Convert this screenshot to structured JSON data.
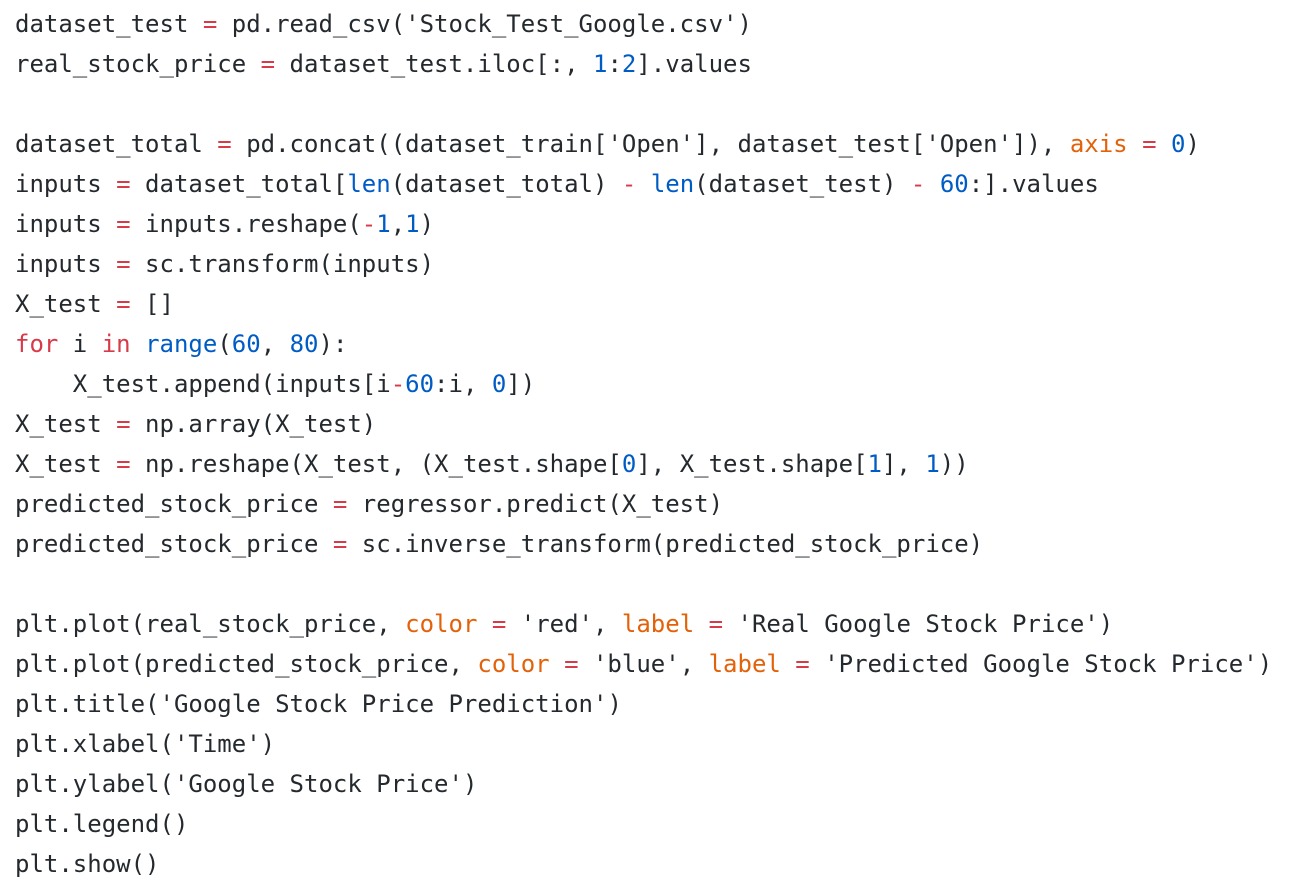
{
  "code": {
    "lines": [
      [
        [
          "t",
          "dataset_test "
        ],
        [
          "o",
          "="
        ],
        [
          "t",
          " pd.read_csv("
        ],
        [
          "s",
          "'Stock_Test_Google.csv'"
        ],
        [
          "t",
          ")"
        ]
      ],
      [
        [
          "t",
          "real_stock_price "
        ],
        [
          "o",
          "="
        ],
        [
          "t",
          " dataset_test.iloc[:, "
        ],
        [
          "n",
          "1"
        ],
        [
          "t",
          ":"
        ],
        [
          "n",
          "2"
        ],
        [
          "t",
          "].values"
        ]
      ],
      [],
      [
        [
          "t",
          "dataset_total "
        ],
        [
          "o",
          "="
        ],
        [
          "t",
          " pd.concat((dataset_train["
        ],
        [
          "s",
          "'Open'"
        ],
        [
          "t",
          "], dataset_test["
        ],
        [
          "s",
          "'Open'"
        ],
        [
          "t",
          "]), "
        ],
        [
          "p",
          "axis"
        ],
        [
          "t",
          " "
        ],
        [
          "o",
          "="
        ],
        [
          "t",
          " "
        ],
        [
          "n",
          "0"
        ],
        [
          "t",
          ")"
        ]
      ],
      [
        [
          "t",
          "inputs "
        ],
        [
          "o",
          "="
        ],
        [
          "t",
          " dataset_total["
        ],
        [
          "b",
          "len"
        ],
        [
          "t",
          "(dataset_total) "
        ],
        [
          "o",
          "-"
        ],
        [
          "t",
          " "
        ],
        [
          "b",
          "len"
        ],
        [
          "t",
          "(dataset_test) "
        ],
        [
          "o",
          "-"
        ],
        [
          "t",
          " "
        ],
        [
          "n",
          "60"
        ],
        [
          "t",
          ":].values"
        ]
      ],
      [
        [
          "t",
          "inputs "
        ],
        [
          "o",
          "="
        ],
        [
          "t",
          " inputs.reshape("
        ],
        [
          "o",
          "-"
        ],
        [
          "n",
          "1"
        ],
        [
          "t",
          ","
        ],
        [
          "n",
          "1"
        ],
        [
          "t",
          ")"
        ]
      ],
      [
        [
          "t",
          "inputs "
        ],
        [
          "o",
          "="
        ],
        [
          "t",
          " sc.transform(inputs)"
        ]
      ],
      [
        [
          "t",
          "X_test "
        ],
        [
          "o",
          "="
        ],
        [
          "t",
          " []"
        ]
      ],
      [
        [
          "k",
          "for"
        ],
        [
          "t",
          " i "
        ],
        [
          "k",
          "in"
        ],
        [
          "t",
          " "
        ],
        [
          "b",
          "range"
        ],
        [
          "t",
          "("
        ],
        [
          "n",
          "60"
        ],
        [
          "t",
          ", "
        ],
        [
          "n",
          "80"
        ],
        [
          "t",
          "):"
        ]
      ],
      [
        [
          "t",
          "    X_test.append(inputs[i"
        ],
        [
          "o",
          "-"
        ],
        [
          "n",
          "60"
        ],
        [
          "t",
          ":i, "
        ],
        [
          "n",
          "0"
        ],
        [
          "t",
          "])"
        ]
      ],
      [
        [
          "t",
          "X_test "
        ],
        [
          "o",
          "="
        ],
        [
          "t",
          " np.array(X_test)"
        ]
      ],
      [
        [
          "t",
          "X_test "
        ],
        [
          "o",
          "="
        ],
        [
          "t",
          " np.reshape(X_test, (X_test.shape["
        ],
        [
          "n",
          "0"
        ],
        [
          "t",
          "], X_test.shape["
        ],
        [
          "n",
          "1"
        ],
        [
          "t",
          "], "
        ],
        [
          "n",
          "1"
        ],
        [
          "t",
          "))"
        ]
      ],
      [
        [
          "t",
          "predicted_stock_price "
        ],
        [
          "o",
          "="
        ],
        [
          "t",
          " regressor.predict(X_test)"
        ]
      ],
      [
        [
          "t",
          "predicted_stock_price "
        ],
        [
          "o",
          "="
        ],
        [
          "t",
          " sc.inverse_transform(predicted_stock_price)"
        ]
      ],
      [],
      [
        [
          "t",
          "plt.plot(real_stock_price, "
        ],
        [
          "p",
          "color"
        ],
        [
          "t",
          " "
        ],
        [
          "o",
          "="
        ],
        [
          "t",
          " "
        ],
        [
          "s",
          "'red'"
        ],
        [
          "t",
          ", "
        ],
        [
          "p",
          "label"
        ],
        [
          "t",
          " "
        ],
        [
          "o",
          "="
        ],
        [
          "t",
          " "
        ],
        [
          "s",
          "'Real Google Stock Price'"
        ],
        [
          "t",
          ")"
        ]
      ],
      [
        [
          "t",
          "plt.plot(predicted_stock_price, "
        ],
        [
          "p",
          "color"
        ],
        [
          "t",
          " "
        ],
        [
          "o",
          "="
        ],
        [
          "t",
          " "
        ],
        [
          "s",
          "'blue'"
        ],
        [
          "t",
          ", "
        ],
        [
          "p",
          "label"
        ],
        [
          "t",
          " "
        ],
        [
          "o",
          "="
        ],
        [
          "t",
          " "
        ],
        [
          "s",
          "'Predicted Google Stock Price'"
        ],
        [
          "t",
          ")"
        ]
      ],
      [
        [
          "t",
          "plt.title("
        ],
        [
          "s",
          "'Google Stock Price Prediction'"
        ],
        [
          "t",
          ")"
        ]
      ],
      [
        [
          "t",
          "plt.xlabel("
        ],
        [
          "s",
          "'Time'"
        ],
        [
          "t",
          ")"
        ]
      ],
      [
        [
          "t",
          "plt.ylabel("
        ],
        [
          "s",
          "'Google Stock Price'"
        ],
        [
          "t",
          ")"
        ]
      ],
      [
        [
          "t",
          "plt.legend()"
        ]
      ],
      [
        [
          "t",
          "plt.show()"
        ]
      ]
    ]
  },
  "colors": {
    "text": "#24292e",
    "operator": "#d73a49",
    "keyword": "#d73a49",
    "builtin": "#005cc5",
    "number": "#005cc5",
    "param": "#e36209",
    "background": "#ffffff"
  }
}
